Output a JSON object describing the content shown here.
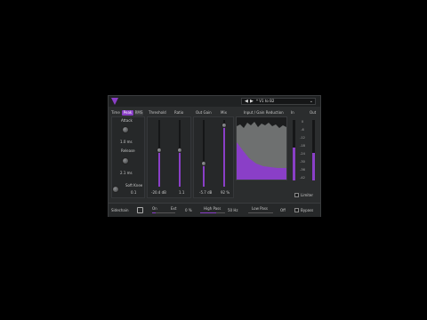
{
  "plugin": {
    "name": "",
    "preset": {
      "prev": "◀",
      "next": "▶",
      "name": "* V1 to B2",
      "dropdown": "⌄"
    }
  },
  "detector": {
    "time_label": "Time",
    "modes": [
      {
        "label": "Peak",
        "active": true
      },
      {
        "label": "RMS",
        "active": false
      }
    ],
    "attack_label": "Attack",
    "attack_value": "1.0 ms",
    "release_label": "Release",
    "release_value": "2.1 ms",
    "soft_knee_label": "Soft Knee",
    "soft_knee_value": "0.1"
  },
  "sliders": {
    "threshold": {
      "label": "Threshold",
      "value": "-20.4 dB",
      "level": 0.55
    },
    "ratio": {
      "label": "Ratio",
      "value": "1.1",
      "level": 0.55
    },
    "out_gain": {
      "label": "Out Gain",
      "value": "-5.7 dB",
      "level": 0.35
    },
    "mix": {
      "label": "Mix",
      "value": "92 %",
      "level": 0.92
    }
  },
  "graph": {
    "label": "Input / Gain Reduction"
  },
  "meters": {
    "in_label": "In",
    "out_label": "Out",
    "scale": [
      "0",
      "-6",
      "-12",
      "-18",
      "-24",
      "-30",
      "-36",
      "-42"
    ],
    "in_level": 0.55,
    "out_level": 0.45,
    "limiter_label": "Limiter"
  },
  "bottom": {
    "sidechain_label": "Sidechain",
    "on_label": "On",
    "ext_label": "Ext",
    "percent": "0 %",
    "high_pass_label": "High Pass",
    "high_pass_value": "50 Hz",
    "low_pass_label": "Low Pass",
    "low_pass_value": "Off",
    "bypass_label": "Bypass"
  },
  "colors": {
    "accent": "#8a3fc7",
    "panel": "#2b2d2e",
    "background": "#000000"
  }
}
